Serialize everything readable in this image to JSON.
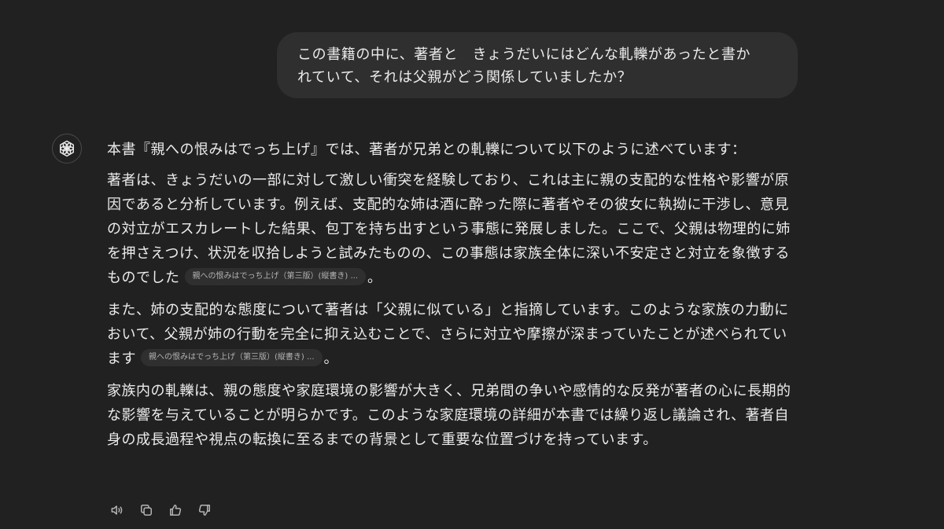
{
  "user_message": {
    "line1": "この書籍の中に、著者と　きょうだいにはどんな軋轢があったと書か",
    "line2": "れていて、それは父親がどう関係していましたか？"
  },
  "assistant": {
    "avatar_icon": "openai-logo-icon",
    "intro": "本書『親への恨みはでっち上げ』では、著者が兄弟との軋轢について以下のように述べています：",
    "paragraph1": "著者は、きょうだいの一部に対して激しい衝突を経験しており、これは主に親の支配的な性格や影響が原因であると分析しています。例えば、支配的な姉は酒に酔った際に著者やその彼女に執拗に干渉し、意見の対立がエスカレートした結果、包丁を持ち出すという事態に発展しました。ここで、父親は物理的に姉を押さえつけ、状況を収拾しようと試みたものの、この事態は家族全体に深い不安定さと対立を象徴するものでした",
    "citation1": "親への恨みはでっち上げ（第三版）(縦書き) ...",
    "paragraph1_end": "。",
    "paragraph2": "また、姉の支配的な態度について著者は「父親に似ている」と指摘しています。このような家族の力動において、父親が姉の行動を完全に抑え込むことで、さらに対立や摩擦が深まっていたことが述べられています",
    "citation2": "親への恨みはでっち上げ（第三版）(縦書き) ...",
    "paragraph2_end": "。",
    "paragraph3": "家族内の軋轢は、親の態度や家庭環境の影響が大きく、兄弟間の争いや感情的な反発が著者の心に長期的な影響を与えていることが明らかです。このような家庭環境の詳細が本書では繰り返し議論され、著者自身の成長過程や視点の転換に至るまでの背景として重要な位置づけを持っています。"
  },
  "actions": [
    {
      "name": "read-aloud",
      "icon": "speaker-icon"
    },
    {
      "name": "copy",
      "icon": "copy-icon"
    },
    {
      "name": "good-response",
      "icon": "thumbs-up-icon"
    },
    {
      "name": "bad-response",
      "icon": "thumbs-down-icon"
    }
  ],
  "colors": {
    "background": "#212121",
    "bubble": "#2f2f2f",
    "text": "#ececec",
    "muted": "#b4b4b4"
  }
}
